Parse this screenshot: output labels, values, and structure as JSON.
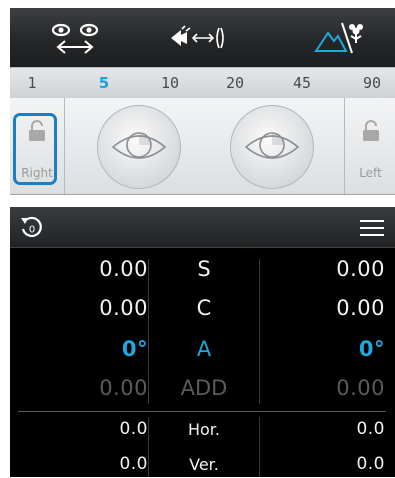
{
  "toolbar": {
    "buttons": [
      {
        "name": "eyes-distance-icon"
      },
      {
        "name": "hand-swipe-icon"
      },
      {
        "name": "mountain-flower-icon"
      }
    ],
    "accent": "#1ea8dd"
  },
  "scale": {
    "items": [
      "1",
      "5",
      "10",
      "20",
      "45",
      "90"
    ],
    "active_index": 1
  },
  "eyes": {
    "right_label": "Right",
    "left_label": "Left"
  },
  "panel": {
    "header": {
      "reset_badge": "0"
    },
    "rows": [
      {
        "right": "0.00",
        "label": "S",
        "left": "0.00",
        "style": "normal"
      },
      {
        "right": "0.00",
        "label": "C",
        "left": "0.00",
        "style": "normal"
      },
      {
        "right": "0°",
        "label": "A",
        "left": "0°",
        "style": "cyan"
      },
      {
        "right": "0.00",
        "label": "ADD",
        "left": "0.00",
        "style": "dim"
      },
      {
        "right": "0.0",
        "label": "Hor.",
        "left": "0.0",
        "style": "small"
      },
      {
        "right": "0.0",
        "label": "Ver.",
        "left": "0.0",
        "style": "small"
      }
    ]
  }
}
